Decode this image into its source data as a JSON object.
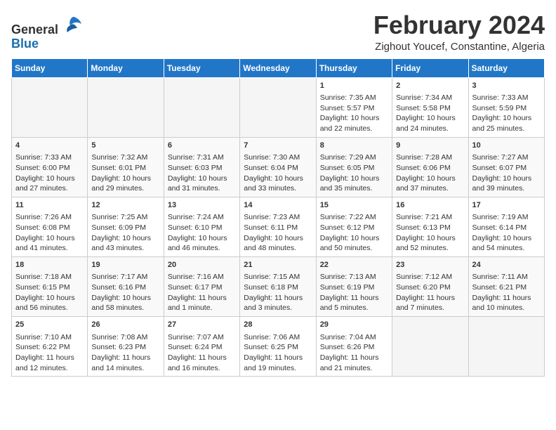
{
  "header": {
    "logo_general": "General",
    "logo_blue": "Blue",
    "title": "February 2024",
    "subtitle": "Zighout Youcef, Constantine, Algeria"
  },
  "calendar": {
    "days_of_week": [
      "Sunday",
      "Monday",
      "Tuesday",
      "Wednesday",
      "Thursday",
      "Friday",
      "Saturday"
    ],
    "weeks": [
      [
        {
          "day": "",
          "content": ""
        },
        {
          "day": "",
          "content": ""
        },
        {
          "day": "",
          "content": ""
        },
        {
          "day": "",
          "content": ""
        },
        {
          "day": "1",
          "content": "Sunrise: 7:35 AM\nSunset: 5:57 PM\nDaylight: 10 hours\nand 22 minutes."
        },
        {
          "day": "2",
          "content": "Sunrise: 7:34 AM\nSunset: 5:58 PM\nDaylight: 10 hours\nand 24 minutes."
        },
        {
          "day": "3",
          "content": "Sunrise: 7:33 AM\nSunset: 5:59 PM\nDaylight: 10 hours\nand 25 minutes."
        }
      ],
      [
        {
          "day": "4",
          "content": "Sunrise: 7:33 AM\nSunset: 6:00 PM\nDaylight: 10 hours\nand 27 minutes."
        },
        {
          "day": "5",
          "content": "Sunrise: 7:32 AM\nSunset: 6:01 PM\nDaylight: 10 hours\nand 29 minutes."
        },
        {
          "day": "6",
          "content": "Sunrise: 7:31 AM\nSunset: 6:03 PM\nDaylight: 10 hours\nand 31 minutes."
        },
        {
          "day": "7",
          "content": "Sunrise: 7:30 AM\nSunset: 6:04 PM\nDaylight: 10 hours\nand 33 minutes."
        },
        {
          "day": "8",
          "content": "Sunrise: 7:29 AM\nSunset: 6:05 PM\nDaylight: 10 hours\nand 35 minutes."
        },
        {
          "day": "9",
          "content": "Sunrise: 7:28 AM\nSunset: 6:06 PM\nDaylight: 10 hours\nand 37 minutes."
        },
        {
          "day": "10",
          "content": "Sunrise: 7:27 AM\nSunset: 6:07 PM\nDaylight: 10 hours\nand 39 minutes."
        }
      ],
      [
        {
          "day": "11",
          "content": "Sunrise: 7:26 AM\nSunset: 6:08 PM\nDaylight: 10 hours\nand 41 minutes."
        },
        {
          "day": "12",
          "content": "Sunrise: 7:25 AM\nSunset: 6:09 PM\nDaylight: 10 hours\nand 43 minutes."
        },
        {
          "day": "13",
          "content": "Sunrise: 7:24 AM\nSunset: 6:10 PM\nDaylight: 10 hours\nand 46 minutes."
        },
        {
          "day": "14",
          "content": "Sunrise: 7:23 AM\nSunset: 6:11 PM\nDaylight: 10 hours\nand 48 minutes."
        },
        {
          "day": "15",
          "content": "Sunrise: 7:22 AM\nSunset: 6:12 PM\nDaylight: 10 hours\nand 50 minutes."
        },
        {
          "day": "16",
          "content": "Sunrise: 7:21 AM\nSunset: 6:13 PM\nDaylight: 10 hours\nand 52 minutes."
        },
        {
          "day": "17",
          "content": "Sunrise: 7:19 AM\nSunset: 6:14 PM\nDaylight: 10 hours\nand 54 minutes."
        }
      ],
      [
        {
          "day": "18",
          "content": "Sunrise: 7:18 AM\nSunset: 6:15 PM\nDaylight: 10 hours\nand 56 minutes."
        },
        {
          "day": "19",
          "content": "Sunrise: 7:17 AM\nSunset: 6:16 PM\nDaylight: 10 hours\nand 58 minutes."
        },
        {
          "day": "20",
          "content": "Sunrise: 7:16 AM\nSunset: 6:17 PM\nDaylight: 11 hours\nand 1 minute."
        },
        {
          "day": "21",
          "content": "Sunrise: 7:15 AM\nSunset: 6:18 PM\nDaylight: 11 hours\nand 3 minutes."
        },
        {
          "day": "22",
          "content": "Sunrise: 7:13 AM\nSunset: 6:19 PM\nDaylight: 11 hours\nand 5 minutes."
        },
        {
          "day": "23",
          "content": "Sunrise: 7:12 AM\nSunset: 6:20 PM\nDaylight: 11 hours\nand 7 minutes."
        },
        {
          "day": "24",
          "content": "Sunrise: 7:11 AM\nSunset: 6:21 PM\nDaylight: 11 hours\nand 10 minutes."
        }
      ],
      [
        {
          "day": "25",
          "content": "Sunrise: 7:10 AM\nSunset: 6:22 PM\nDaylight: 11 hours\nand 12 minutes."
        },
        {
          "day": "26",
          "content": "Sunrise: 7:08 AM\nSunset: 6:23 PM\nDaylight: 11 hours\nand 14 minutes."
        },
        {
          "day": "27",
          "content": "Sunrise: 7:07 AM\nSunset: 6:24 PM\nDaylight: 11 hours\nand 16 minutes."
        },
        {
          "day": "28",
          "content": "Sunrise: 7:06 AM\nSunset: 6:25 PM\nDaylight: 11 hours\nand 19 minutes."
        },
        {
          "day": "29",
          "content": "Sunrise: 7:04 AM\nSunset: 6:26 PM\nDaylight: 11 hours\nand 21 minutes."
        },
        {
          "day": "",
          "content": ""
        },
        {
          "day": "",
          "content": ""
        }
      ]
    ]
  }
}
